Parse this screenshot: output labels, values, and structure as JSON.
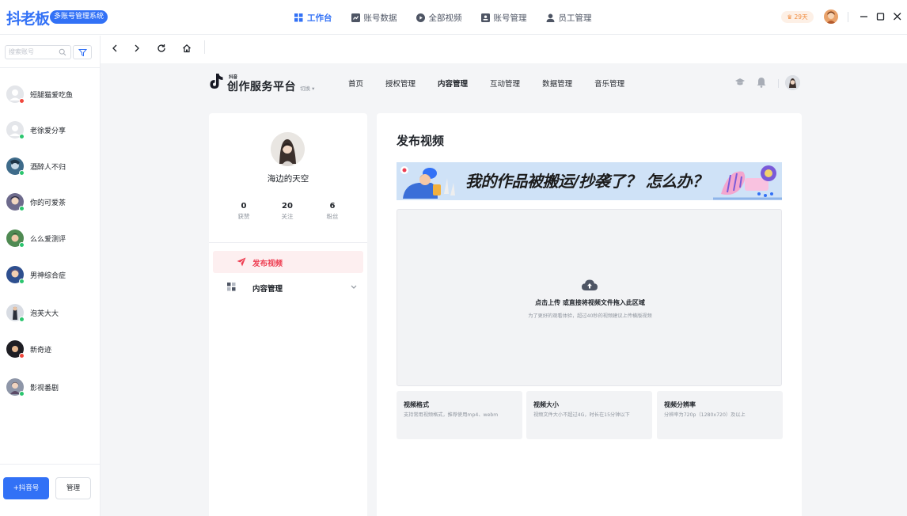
{
  "app": {
    "logo": "抖老板",
    "system_badge": "多账号管理系统"
  },
  "topnav": [
    {
      "label": "工作台",
      "icon": "grid-icon",
      "active": true
    },
    {
      "label": "账号数据",
      "icon": "chart-icon",
      "active": false
    },
    {
      "label": "全部视频",
      "icon": "play-icon",
      "active": false
    },
    {
      "label": "账号管理",
      "icon": "id-card-icon",
      "active": false
    },
    {
      "label": "员工管理",
      "icon": "user-icon",
      "active": false
    }
  ],
  "vip": {
    "label": "29天",
    "icon": "crown-icon"
  },
  "window_controls": [
    "minimize",
    "maximize",
    "close"
  ],
  "sidebar": {
    "search_placeholder": "搜索账号",
    "accounts": [
      {
        "name": "短腿猫爱吃鱼",
        "status": "offline"
      },
      {
        "name": "老徐爱分享",
        "status": "online"
      },
      {
        "name": "酒醉人不归",
        "status": "online"
      },
      {
        "name": "你的可爱茶",
        "status": "online"
      },
      {
        "name": "么么爱测评",
        "status": "online"
      },
      {
        "name": "男神综合症",
        "status": "online"
      },
      {
        "name": "泡芙大大",
        "status": "online"
      },
      {
        "name": "新奇迹",
        "status": "offline"
      },
      {
        "name": "影视番剧",
        "status": "online"
      }
    ],
    "add_button": "+抖音号",
    "manage_button": "管理"
  },
  "creator": {
    "small_label": "抖音",
    "title": "创作服务平台",
    "switch_label": "切换",
    "nav": [
      {
        "label": "首页",
        "active": false
      },
      {
        "label": "授权管理",
        "active": false
      },
      {
        "label": "内容管理",
        "active": true
      },
      {
        "label": "互动管理",
        "active": false
      },
      {
        "label": "数据管理",
        "active": false
      },
      {
        "label": "音乐管理",
        "active": false
      }
    ]
  },
  "profile": {
    "name": "海边的天空",
    "stats": [
      {
        "value": "0",
        "label": "获赞"
      },
      {
        "value": "20",
        "label": "关注"
      },
      {
        "value": "6",
        "label": "粉丝"
      }
    ],
    "menu": [
      {
        "label": "发布视频",
        "icon": "send-icon",
        "active": true
      },
      {
        "label": "内容管理",
        "icon": "grid-icon",
        "active": false
      }
    ]
  },
  "publish": {
    "title": "发布视频",
    "banner_text": "我的作品被搬运/抄袭了？ 怎么办？",
    "upload_title": "点击上传 或直接将视频文件拖入此区域",
    "upload_hint": "为了更好的观看体验，超过40秒的视频建议上传横版视频",
    "specs": [
      {
        "title": "视频格式",
        "desc": "支持常用视频格式，推荐使用mp4、webm"
      },
      {
        "title": "视频大小",
        "desc": "视频文件大小不超过4G，时长在15分钟以下"
      },
      {
        "title": "视频分辨率",
        "desc": "分辨率为720p（1280x720）及以上"
      }
    ]
  },
  "colors": {
    "brand_blue": "#3271f6",
    "accent_red": "#ee3e52",
    "online_green": "#2bc56e",
    "offline_red": "#f0473c"
  }
}
